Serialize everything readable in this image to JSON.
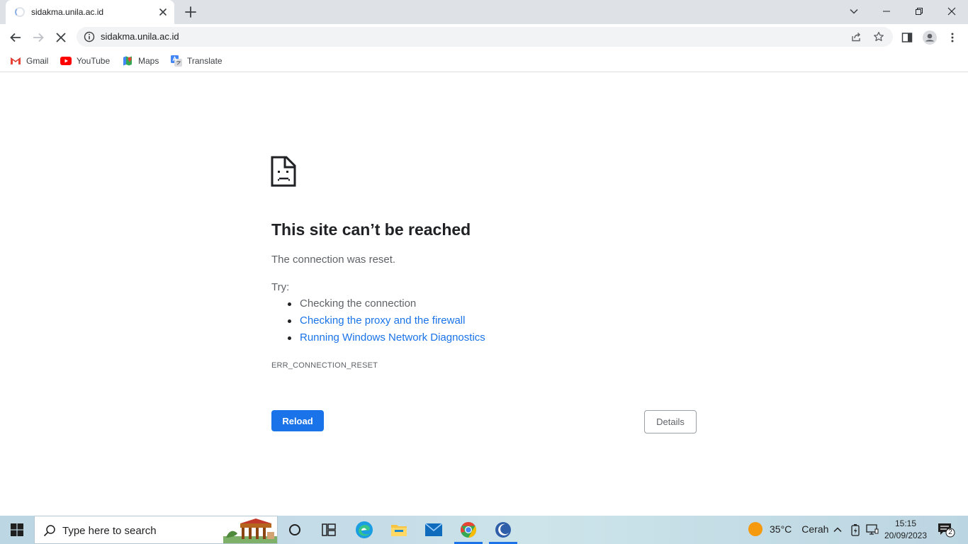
{
  "browser": {
    "tab": {
      "title": "sidakma.unila.ac.id"
    },
    "address_bar": {
      "url": "sidakma.unila.ac.id"
    },
    "bookmarks": [
      {
        "label": "Gmail"
      },
      {
        "label": "YouTube"
      },
      {
        "label": "Maps"
      },
      {
        "label": "Translate"
      }
    ]
  },
  "error_page": {
    "title": "This site can’t be reached",
    "description": "The connection was reset.",
    "try_label": "Try:",
    "suggestions": [
      {
        "text": "Checking the connection",
        "is_link": false
      },
      {
        "text": "Checking the proxy and the firewall",
        "is_link": true
      },
      {
        "text": "Running Windows Network Diagnostics",
        "is_link": true
      }
    ],
    "error_code": "ERR_CONNECTION_RESET",
    "reload_label": "Reload",
    "details_label": "Details"
  },
  "taskbar": {
    "search_placeholder": "Type here to search",
    "weather": {
      "temperature": "35°C",
      "condition": "Cerah"
    },
    "clock": {
      "time": "15:15",
      "date": "20/09/2023"
    },
    "notification_count": "2",
    "pinned_apps": [
      "cortana",
      "task-view",
      "edge",
      "file-explorer",
      "mail",
      "chrome",
      "app"
    ]
  },
  "colors": {
    "accent": "#1a73e8",
    "tabstrip_bg": "#dee1e6",
    "link": "#1a73e8"
  }
}
